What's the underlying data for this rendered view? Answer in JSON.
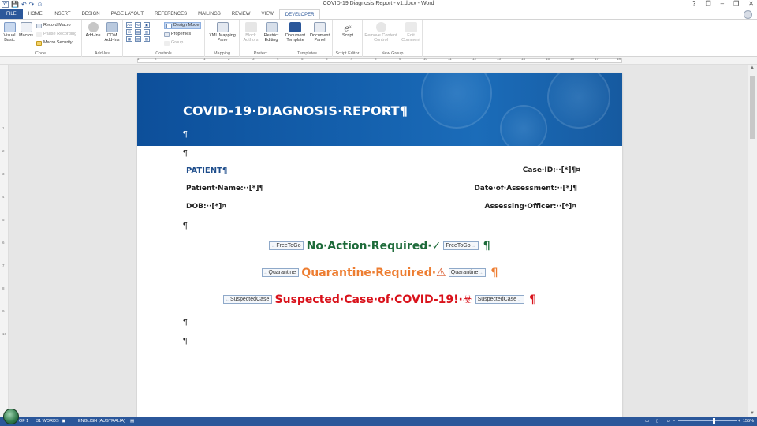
{
  "window": {
    "title": "COVID-19 Diagnosis Report - v1.docx - Word",
    "controls": [
      "?",
      "❒",
      "–",
      "❒",
      "✕"
    ]
  },
  "qat": {
    "save": "💾",
    "undo": "↶",
    "redo": "↷",
    "smiley": "☺"
  },
  "tabs": [
    "FILE",
    "HOME",
    "INSERT",
    "DESIGN",
    "PAGE LAYOUT",
    "REFERENCES",
    "MAILINGS",
    "REVIEW",
    "VIEW",
    "DEVELOPER"
  ],
  "ribbon": {
    "code": {
      "label": "Code",
      "visual_basic": "Visual Basic",
      "macros": "Macros",
      "record_macro": "Record Macro",
      "pause_recording": "Pause Recording",
      "macro_security": "Macro Security"
    },
    "addins": {
      "label": "Add-Ins",
      "addins": "Add-Ins",
      "com_addins": "COM Add-Ins"
    },
    "controls": {
      "label": "Controls",
      "design_mode": "Design Mode",
      "properties": "Properties",
      "group": "Group"
    },
    "mapping": {
      "label": "Mapping",
      "xml_pane": "XML Mapping Pane"
    },
    "protect": {
      "label": "Protect",
      "block_authors": "Block Authors",
      "restrict_editing": "Restrict Editing"
    },
    "templates": {
      "label": "Templates",
      "document_template": "Document Template",
      "document_panel": "Document Panel"
    },
    "script_editor": {
      "label": "Script Editor",
      "script": "Script"
    },
    "new_group": {
      "label": "New Group",
      "remove_content_control": "Remove Content Control",
      "edit_comment": "Edit Comment"
    }
  },
  "document": {
    "title": "COVID-19·DIAGNOSIS·REPORT¶",
    "pilcrow": "¶",
    "patient_heading": "PATIENT¶",
    "case_id": "Case·ID:··[*]¶¤",
    "patient_name": "Patient·Name:··[*]¶",
    "date_of_assessment": "Date·of·Assessment:··[*]¶",
    "dob": "DOB:··[*]¤",
    "assessing_officer": "Assessing·Officer:··[*]¤",
    "outcomes": [
      {
        "tag": "FreeToGo",
        "text": "No·Action·Required·",
        "symbol": "✓",
        "color": "#1e6b3a"
      },
      {
        "tag": "Quarantine",
        "text": "Quarantine·Required·",
        "symbol": "⚠",
        "color": "#ed7d31"
      },
      {
        "tag": "SuspectedCase",
        "text": "Suspected·Case·of·COVID-19!·",
        "symbol": "☣",
        "color": "#d9121b"
      }
    ]
  },
  "ruler": {
    "h_ticks": [
      "1",
      "2",
      "1",
      "1",
      "2",
      "3",
      "4",
      "5",
      "6",
      "7",
      "8",
      "9",
      "10",
      "11",
      "12",
      "13",
      "14",
      "15",
      "16",
      "17",
      "18"
    ],
    "v_ticks": [
      "1",
      "2",
      "3",
      "4",
      "5",
      "6",
      "7",
      "8",
      "9",
      "10"
    ]
  },
  "status": {
    "page": "OF 1",
    "words": "31 WORDS",
    "language": "ENGLISH (AUSTRALIA)",
    "zoom": "155%"
  },
  "colors": {
    "accent": "#2b579a",
    "banner": "#1460ad",
    "heading": "#1f4e8c"
  }
}
